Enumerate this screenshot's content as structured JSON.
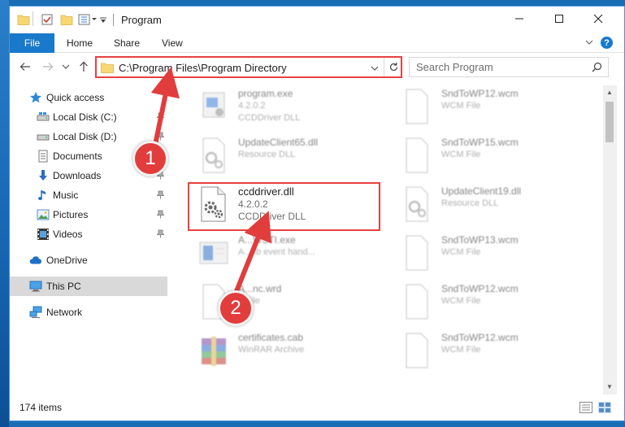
{
  "window": {
    "title": "Program",
    "accent": "#1979ca",
    "highlight_color": "#e84040"
  },
  "ribbon": {
    "tabs": [
      {
        "label": "File"
      },
      {
        "label": "Home"
      },
      {
        "label": "Share"
      },
      {
        "label": "View"
      }
    ],
    "help_label": "?"
  },
  "nav": {
    "address": "C:\\Program Files\\Program Directory",
    "search_placeholder": "Search Program"
  },
  "sidebar": {
    "items": [
      {
        "label": "Quick access",
        "icon": "star-icon"
      },
      {
        "label": "Local Disk (C:)",
        "icon": "drive-icon"
      },
      {
        "label": "Local Disk (D:)",
        "icon": "drive-icon"
      },
      {
        "label": "Documents",
        "icon": "documents-icon"
      },
      {
        "label": "Downloads",
        "icon": "download-icon"
      },
      {
        "label": "Music",
        "icon": "music-icon"
      },
      {
        "label": "Pictures",
        "icon": "pictures-icon"
      },
      {
        "label": "Videos",
        "icon": "videos-icon"
      },
      {
        "label": "OneDrive",
        "icon": "cloud-icon"
      },
      {
        "label": "This PC",
        "icon": "computer-icon"
      },
      {
        "label": "Network",
        "icon": "network-icon"
      }
    ]
  },
  "files": {
    "left": [
      {
        "name": "program.exe",
        "line2": "4.2.0.2",
        "line3": "CCDDriver DLL",
        "icon": "exe-icon"
      },
      {
        "name": "UpdateClient65.dll",
        "line2": "Resource DLL",
        "line3": "",
        "icon": "dll-gear-icon"
      },
      {
        "name": "ccddriver.dll",
        "line2": "4.2.0.2",
        "line3": "CCDDriver DLL",
        "icon": "dll-gear-icon"
      },
      {
        "name": "A...WSTI.exe",
        "line2": "A... ib event hand...",
        "line3": "",
        "icon": "app-window-icon"
      },
      {
        "name": "A...nc.wrd",
        "line2": "...File",
        "line3": "",
        "icon": "blank-file-icon"
      },
      {
        "name": "certificates.cab",
        "line2": "WinRAR Archive",
        "line3": "",
        "icon": "archive-icon"
      }
    ],
    "right": [
      {
        "name": "SndToWP12.wcm",
        "line2": "WCM File",
        "icon": "blank-file-icon"
      },
      {
        "name": "SndToWP15.wcm",
        "line2": "WCM File",
        "icon": "blank-file-icon"
      },
      {
        "name": "UpdateClient19.dll",
        "line2": "Resource DLL",
        "icon": "dll-gear-icon"
      },
      {
        "name": "SndToWP13.wcm",
        "line2": "WCM File",
        "icon": "blank-file-icon"
      },
      {
        "name": "SndToWP12.wcm",
        "line2": "WCM File",
        "icon": "blank-file-icon"
      },
      {
        "name": "SndToWP12.wcm",
        "line2": "WCM File",
        "icon": "blank-file-icon"
      }
    ]
  },
  "status": {
    "item_count": "174 items"
  },
  "steps": [
    "1",
    "2"
  ]
}
